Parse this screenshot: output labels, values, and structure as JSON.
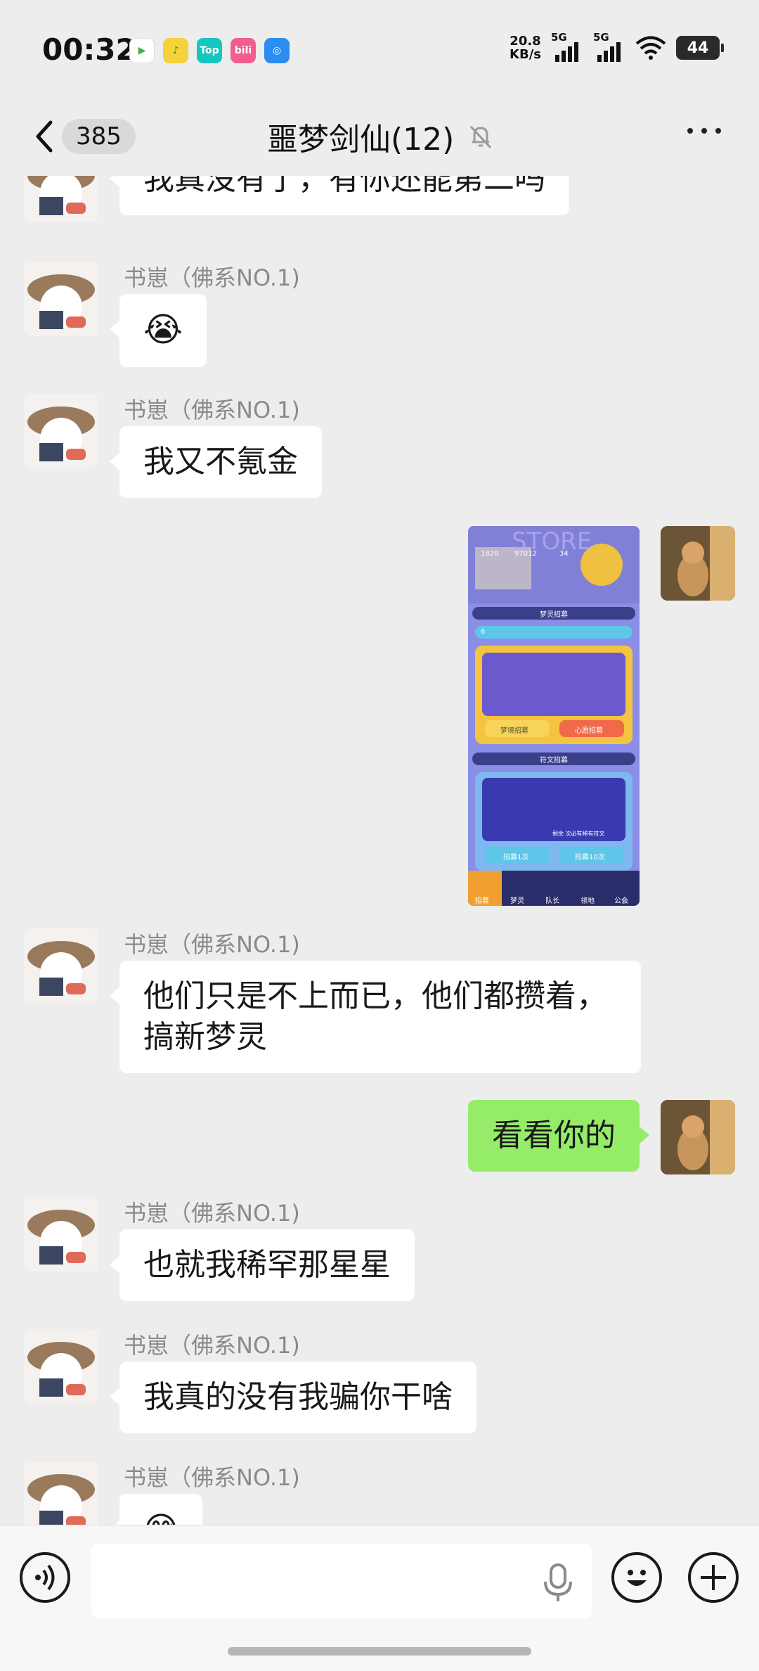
{
  "status_bar": {
    "time": "00:32",
    "net_speed_value": "20.8",
    "net_speed_unit": "KB/s",
    "signal1_label": "5G",
    "signal2_label": "5G",
    "battery": "44",
    "app_icons": [
      {
        "name": "video-app-icon",
        "text": "▶",
        "color": "#ffffff"
      },
      {
        "name": "music-app-icon",
        "text": "♪",
        "color": "#f5d23a"
      },
      {
        "name": "top-app-icon",
        "text": "Top",
        "color": "#15c5c0"
      },
      {
        "name": "bilibili-app-icon",
        "text": "bili",
        "color": "#f25d8e"
      },
      {
        "name": "browser-app-icon",
        "text": "◎",
        "color": "#2b8cf2"
      }
    ]
  },
  "nav": {
    "unread_count": "385",
    "title": "噩梦剑仙(12)"
  },
  "messages": [
    {
      "side": "left",
      "sender": "",
      "text": "我真没有了，有你还能第二吗"
    },
    {
      "side": "left",
      "sender": "书崽（佛系NO.1)",
      "emoji": "😭"
    },
    {
      "side": "left",
      "sender": "书崽（佛系NO.1)",
      "text": "我又不氪金"
    },
    {
      "side": "right",
      "image": "game-store-screenshot"
    },
    {
      "side": "left",
      "sender": "书崽（佛系NO.1)",
      "text_line1": "他们只是不上而已，他们都攒着，",
      "text_line2": "搞新梦灵"
    },
    {
      "side": "right",
      "text": "看看你的"
    },
    {
      "side": "left",
      "sender": "书崽（佛系NO.1)",
      "text": "也就我稀罕那星星"
    },
    {
      "side": "left",
      "sender": "书崽（佛系NO.1)",
      "text": "我真的没有我骗你干啥"
    },
    {
      "side": "left",
      "sender": "书崽（佛系NO.1)",
      "emoji": "😅"
    }
  ],
  "screenshot": {
    "store_title": "STORE",
    "stat1": "1820",
    "stat2": "97012",
    "stat3": "34",
    "section1": "梦灵招募",
    "level": "6",
    "btn1": "梦境招募",
    "btn2": "心愿招募",
    "section2": "符文招募",
    "rune_caption": "剩余 次必有稀有符文",
    "btn3": "招募1次",
    "btn4": "招募10次",
    "tabs": [
      "招募",
      "梦灵",
      "队长",
      "领地",
      "公会"
    ]
  },
  "input": {
    "placeholder": ""
  }
}
